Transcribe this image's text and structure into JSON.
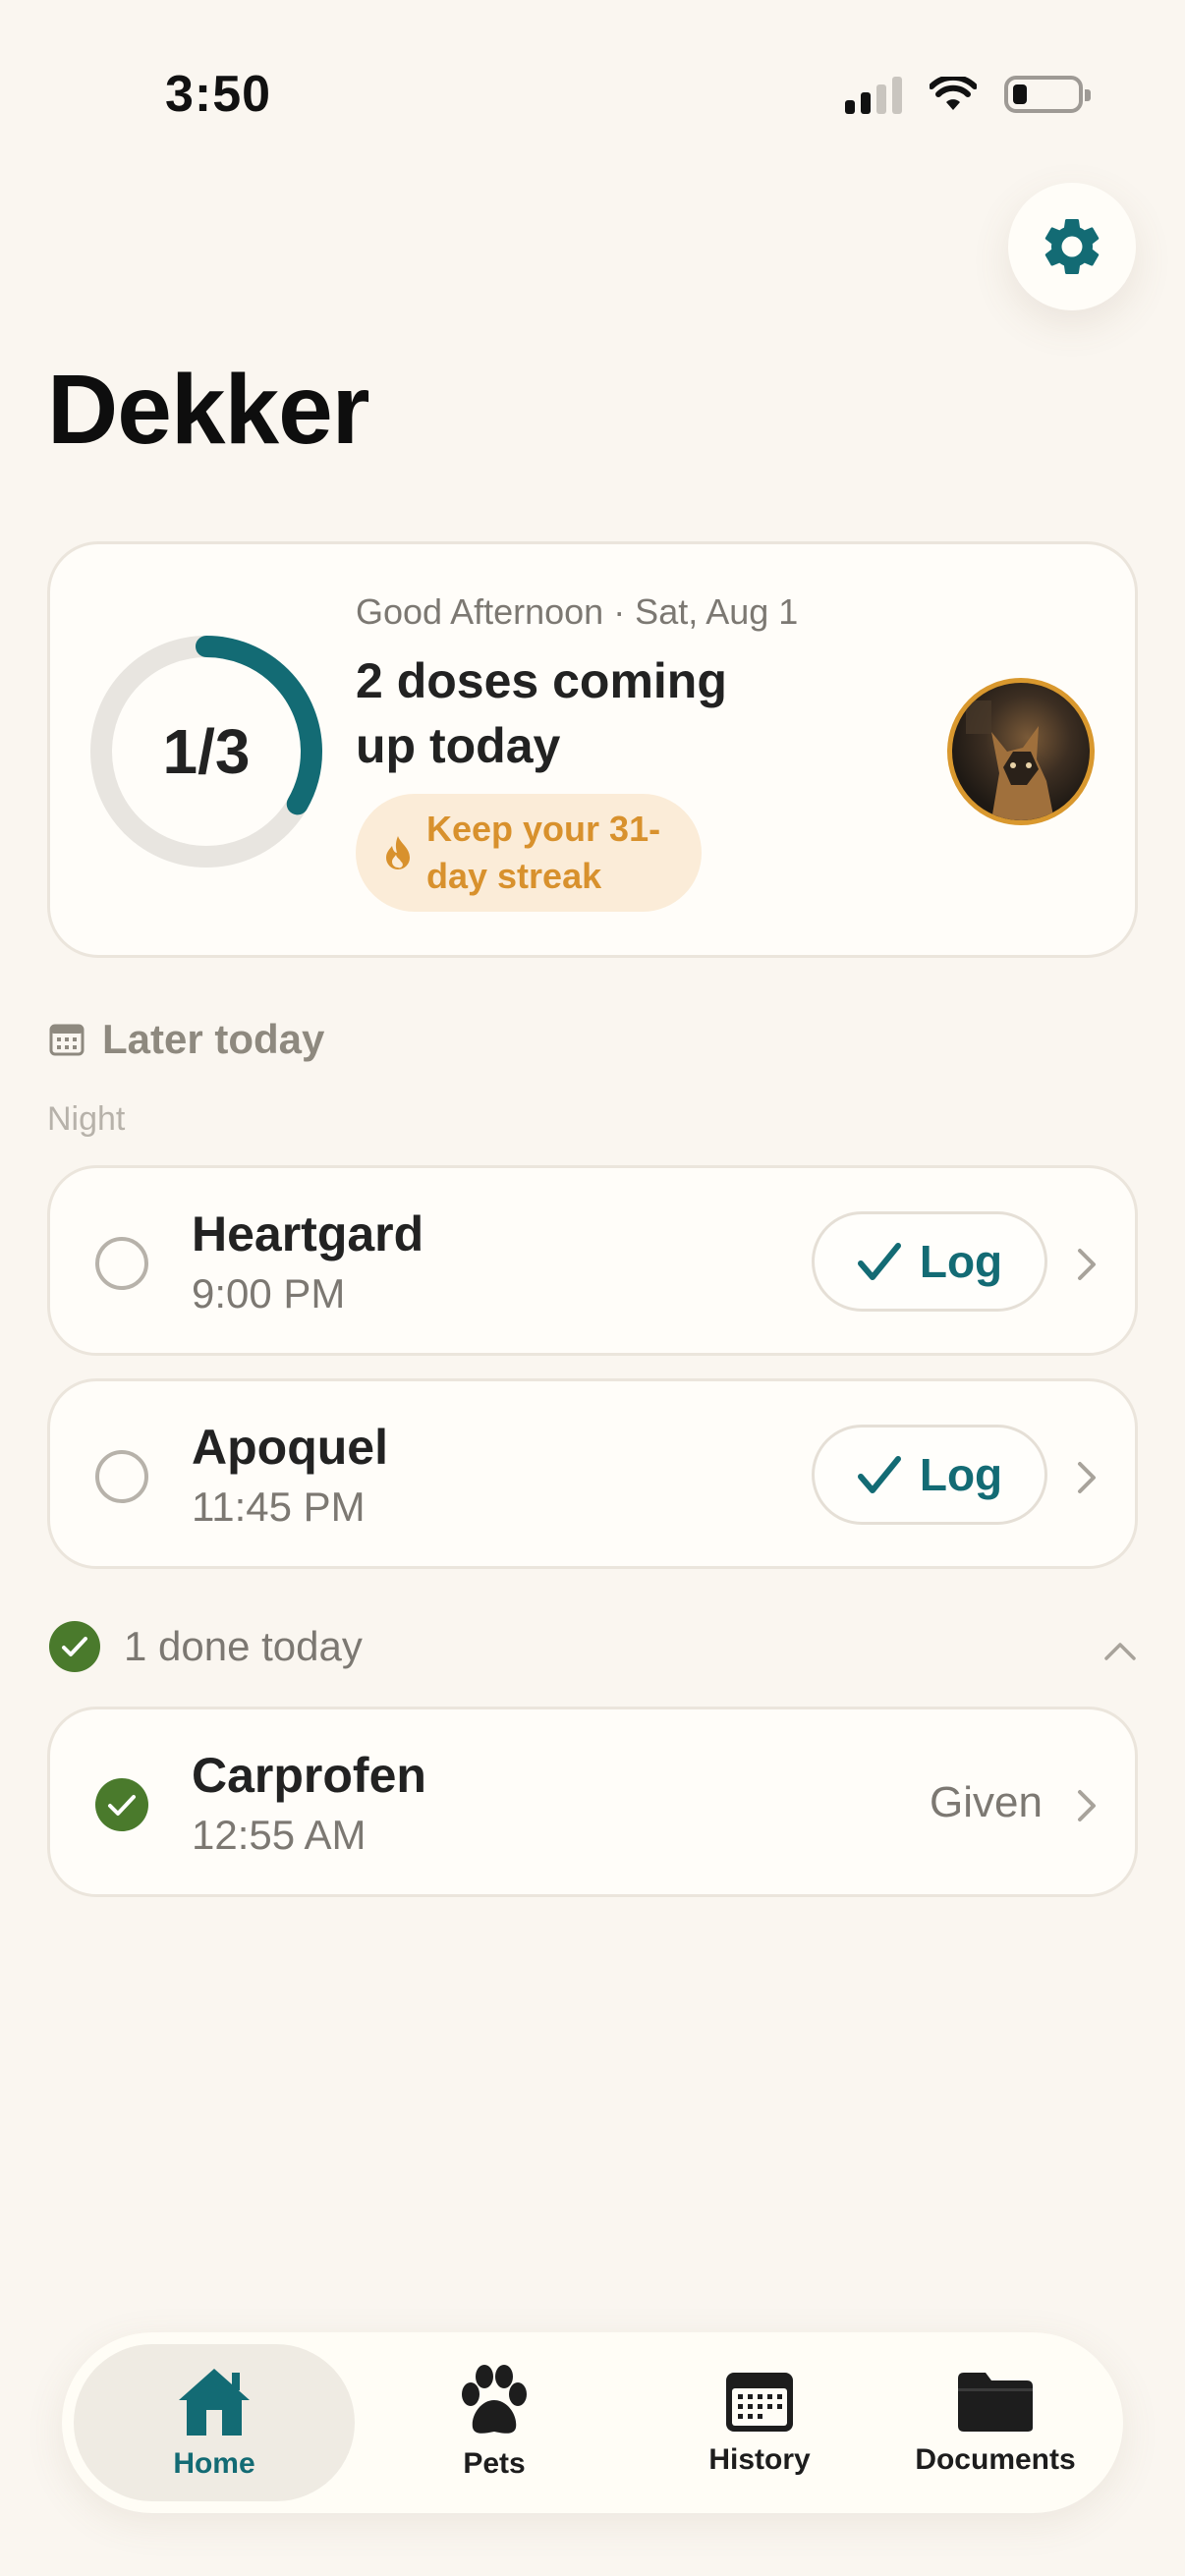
{
  "status_bar": {
    "time": "3:50"
  },
  "page": {
    "title": "Dekker"
  },
  "summary": {
    "progress_text": "1/3",
    "progress_fraction": 0.333,
    "greeting": "Good Afternoon · Sat, Aug 1",
    "headline": "2 doses coming up today",
    "streak": "Keep your 31-day streak",
    "accent_color": "#136b74",
    "streak_color": "#d8912d"
  },
  "later_section": {
    "title": "Later today",
    "period": "Night",
    "doses": [
      {
        "name": "Heartgard",
        "time": "9:00 PM",
        "action": "Log"
      },
      {
        "name": "Apoquel",
        "time": "11:45 PM",
        "action": "Log"
      }
    ]
  },
  "done_section": {
    "title": "1 done today",
    "doses": [
      {
        "name": "Carprofen",
        "time": "12:55 AM",
        "status": "Given"
      }
    ]
  },
  "tabs": [
    {
      "label": "Home",
      "icon": "house-icon",
      "active": true
    },
    {
      "label": "Pets",
      "icon": "paw-icon",
      "active": false
    },
    {
      "label": "History",
      "icon": "calendar-icon",
      "active": false
    },
    {
      "label": "Documents",
      "icon": "folder-icon",
      "active": false
    }
  ]
}
